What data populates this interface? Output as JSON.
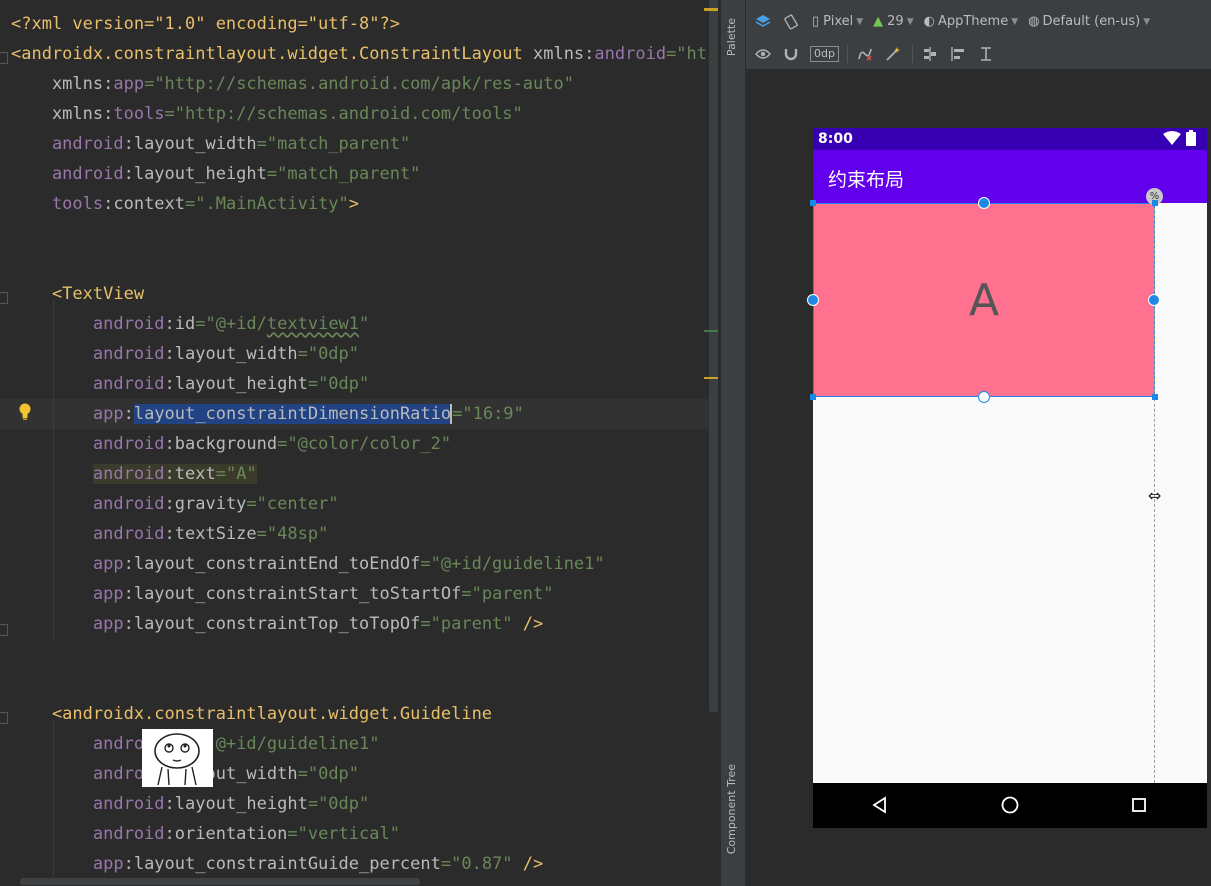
{
  "editor": {
    "lines": [
      {
        "tokens": [
          {
            "t": "<?xml version=\"1.0\" encoding=\"utf-8\"?>",
            "c": "pi"
          }
        ]
      },
      {
        "tokens": [
          {
            "t": "<androidx.constraintlayout.widget.ConstraintLayout ",
            "c": "tag"
          },
          {
            "t": "xmlns:",
            "c": "attr"
          },
          {
            "t": "android",
            "c": "ns"
          },
          {
            "t": "=\"ht",
            "c": "str"
          }
        ]
      },
      {
        "tokens": [
          {
            "t": "    xmlns:",
            "c": "attr"
          },
          {
            "t": "app",
            "c": "ns"
          },
          {
            "t": "=\"http://schemas.android.com/apk/res-auto\"",
            "c": "str"
          }
        ]
      },
      {
        "tokens": [
          {
            "t": "    xmlns:",
            "c": "attr"
          },
          {
            "t": "tools",
            "c": "ns"
          },
          {
            "t": "=\"http://schemas.android.com/tools\"",
            "c": "str"
          }
        ]
      },
      {
        "tokens": [
          {
            "t": "    android",
            "c": "ns"
          },
          {
            "t": ":layout_width",
            "c": "attr"
          },
          {
            "t": "=\"match_parent\"",
            "c": "str"
          }
        ]
      },
      {
        "tokens": [
          {
            "t": "    android",
            "c": "ns"
          },
          {
            "t": ":layout_height",
            "c": "attr"
          },
          {
            "t": "=\"match_parent\"",
            "c": "str"
          }
        ]
      },
      {
        "tokens": [
          {
            "t": "    tools",
            "c": "ns"
          },
          {
            "t": ":context",
            "c": "attr"
          },
          {
            "t": "=\".MainActivity\"",
            "c": "str"
          },
          {
            "t": ">",
            "c": "tag"
          }
        ]
      },
      {
        "tokens": []
      },
      {
        "tokens": []
      },
      {
        "tokens": [
          {
            "t": "    <TextView",
            "c": "tag"
          }
        ]
      },
      {
        "tokens": [
          {
            "t": "        android",
            "c": "ns"
          },
          {
            "t": ":id",
            "c": "attr"
          },
          {
            "t": "=\"@+id/",
            "c": "str"
          },
          {
            "t": "textview1",
            "c": "str",
            "wavy": true
          },
          {
            "t": "\"",
            "c": "str"
          }
        ]
      },
      {
        "tokens": [
          {
            "t": "        android",
            "c": "ns"
          },
          {
            "t": ":layout_width",
            "c": "attr"
          },
          {
            "t": "=\"0dp\"",
            "c": "str"
          }
        ]
      },
      {
        "tokens": [
          {
            "t": "        android",
            "c": "ns"
          },
          {
            "t": ":layout_height",
            "c": "attr"
          },
          {
            "t": "=\"0dp\"",
            "c": "str"
          }
        ]
      },
      {
        "tokens": [
          {
            "t": "        app",
            "c": "ns"
          },
          {
            "t": ":",
            "c": "attr"
          },
          {
            "t": "layout_constraintDimensionRatio",
            "c": "attr",
            "sel": true,
            "caret": true
          },
          {
            "t": "=\"16:9\"",
            "c": "str"
          }
        ],
        "current": true
      },
      {
        "tokens": [
          {
            "t": "        android",
            "c": "ns"
          },
          {
            "t": ":background",
            "c": "attr"
          },
          {
            "t": "=\"@color/color_2\"",
            "c": "str"
          }
        ]
      },
      {
        "tokens": [
          {
            "t": "        ",
            "c": "plain"
          },
          {
            "t": "android",
            "c": "ns",
            "hl": true
          },
          {
            "t": ":text",
            "c": "attr",
            "hl": true
          },
          {
            "t": "=\"A\"",
            "c": "str",
            "hl": true
          }
        ]
      },
      {
        "tokens": [
          {
            "t": "        android",
            "c": "ns"
          },
          {
            "t": ":gravity",
            "c": "attr"
          },
          {
            "t": "=\"center\"",
            "c": "str"
          }
        ]
      },
      {
        "tokens": [
          {
            "t": "        android",
            "c": "ns"
          },
          {
            "t": ":textSize",
            "c": "attr"
          },
          {
            "t": "=\"48sp\"",
            "c": "str"
          }
        ]
      },
      {
        "tokens": [
          {
            "t": "        app",
            "c": "ns"
          },
          {
            "t": ":layout_constraintEnd_toEndOf",
            "c": "attr"
          },
          {
            "t": "=\"@+id/guideline1\"",
            "c": "str"
          }
        ]
      },
      {
        "tokens": [
          {
            "t": "        app",
            "c": "ns"
          },
          {
            "t": ":layout_constraintStart_toStartOf",
            "c": "attr"
          },
          {
            "t": "=\"parent\"",
            "c": "str"
          }
        ]
      },
      {
        "tokens": [
          {
            "t": "        app",
            "c": "ns"
          },
          {
            "t": ":layout_constraintTop_toTopOf",
            "c": "attr"
          },
          {
            "t": "=\"parent\"",
            "c": "str"
          },
          {
            "t": " />",
            "c": "tag"
          }
        ]
      },
      {
        "tokens": []
      },
      {
        "tokens": []
      },
      {
        "tokens": [
          {
            "t": "    <androidx.constraintlayout.widget.Guideline",
            "c": "tag"
          }
        ]
      },
      {
        "tokens": [
          {
            "t": "        andro",
            "c": "ns"
          },
          {
            "t": "      ",
            "c": "plain"
          },
          {
            "t": "\"@+id/guideline1\"",
            "c": "str"
          }
        ]
      },
      {
        "tokens": [
          {
            "t": "        andro",
            "c": "ns"
          },
          {
            "t": "      ",
            "c": "plain"
          },
          {
            "t": "out_width",
            "c": "attr"
          },
          {
            "t": "=\"0dp\"",
            "c": "str"
          }
        ]
      },
      {
        "tokens": [
          {
            "t": "        android",
            "c": "ns"
          },
          {
            "t": ":layout_height",
            "c": "attr"
          },
          {
            "t": "=\"0dp\"",
            "c": "str"
          }
        ]
      },
      {
        "tokens": [
          {
            "t": "        android",
            "c": "ns"
          },
          {
            "t": ":orientation",
            "c": "attr"
          },
          {
            "t": "=\"vertical\"",
            "c": "str"
          }
        ]
      },
      {
        "tokens": [
          {
            "t": "        app",
            "c": "ns"
          },
          {
            "t": ":layout_constraintGuide_percent",
            "c": "attr"
          },
          {
            "t": "=\"0.87\"",
            "c": "str"
          },
          {
            "t": " />",
            "c": "tag"
          }
        ]
      }
    ]
  },
  "side_strip": {
    "palette": "Palette",
    "component_tree": "Component Tree"
  },
  "toolbar": {
    "device": "Pixel",
    "api": "29",
    "theme": "AppTheme",
    "locale": "Default (en-us)",
    "margin": "0dp"
  },
  "preview": {
    "time": "8:00",
    "app_title": "约束布局",
    "textview_text": "A",
    "percent_badge": "%",
    "textview_color": "#fe7290",
    "appbar_color": "#6200ee",
    "statusbar_color": "#3700b3"
  }
}
